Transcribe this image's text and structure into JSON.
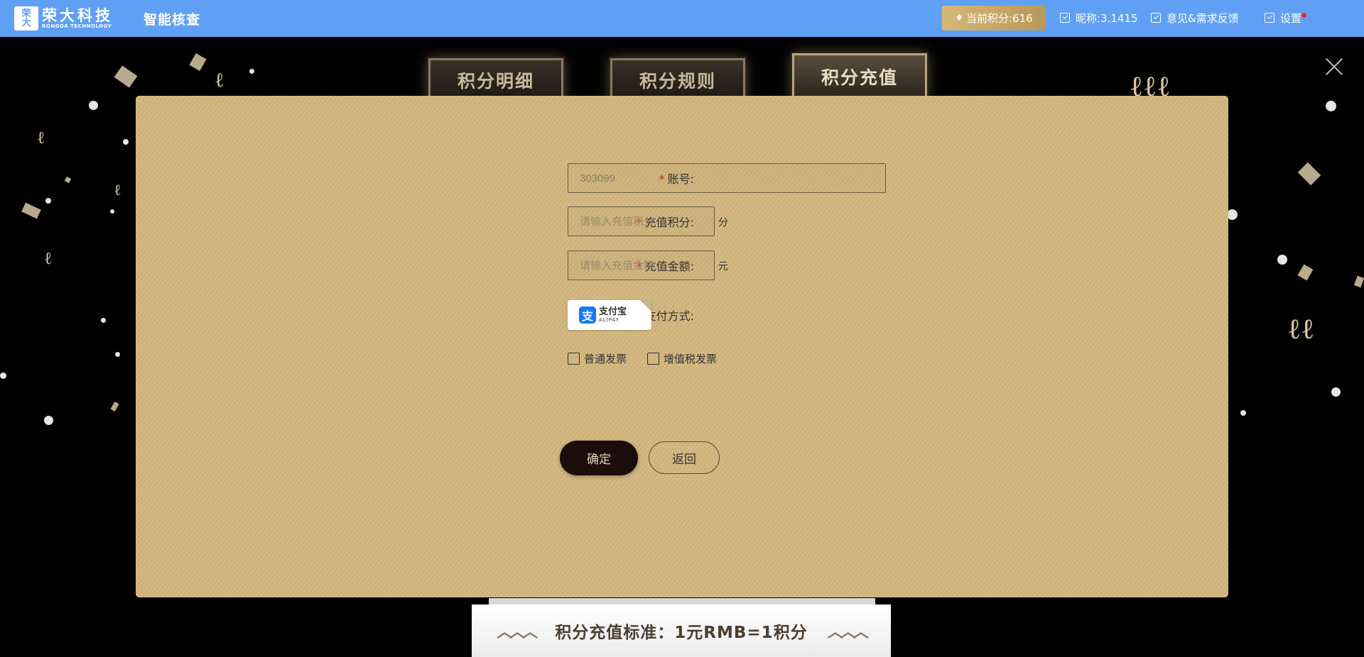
{
  "header": {
    "logo_mark": "荣\n大",
    "logo_cn": "荣大科技",
    "logo_en": "RONGDA TECHNOLOGY",
    "app_title": "智能核查",
    "points": "当前积分:616",
    "nickname": "昵称:3.1415",
    "feedback": "意见&需求反馈",
    "settings": "设置"
  },
  "tabs": [
    {
      "label": "积分明细",
      "active": false
    },
    {
      "label": "积分规则",
      "active": false
    },
    {
      "label": "积分充值",
      "active": true
    }
  ],
  "form": {
    "account_label": "账号:",
    "account_value": "303099",
    "points_label": "充值积分:",
    "points_placeholder": "请输入充值积分",
    "points_unit": "分",
    "amount_label": "充值金额:",
    "amount_placeholder": "请输入充值金额",
    "amount_unit": "元",
    "payment_label": "选择支付方式:",
    "alipay_cn": "支付宝",
    "alipay_en": "ALIPAY",
    "invoice_normal": "普通发票",
    "invoice_vat": "增值税发票",
    "required_mark": "*"
  },
  "buttons": {
    "confirm": "确定",
    "back": "返回"
  },
  "banner": {
    "text": "积分充值标准：1元RMB=1积分"
  },
  "colors": {
    "header_bg": "#5fa0f5",
    "panel_bg": "#d7b97e",
    "confirm_bg": "#1a0d0b",
    "required": "#e02020"
  }
}
